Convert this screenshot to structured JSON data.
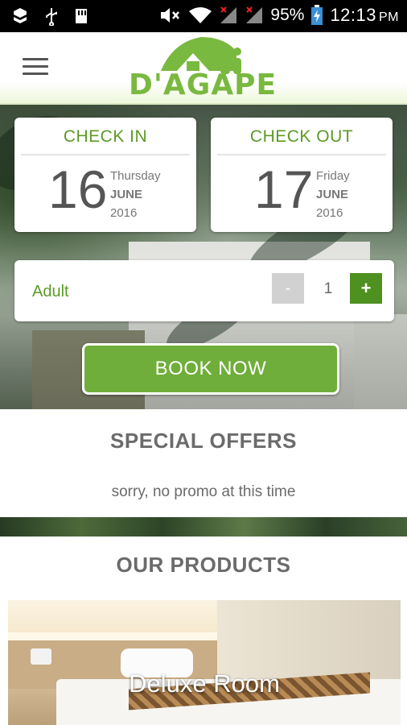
{
  "status_bar": {
    "battery_percent": "95%",
    "time": "12:13",
    "time_suffix": "PM"
  },
  "header": {
    "logo_text": "D'AGAPE",
    "brand_color": "#79b93f"
  },
  "booking": {
    "check_in": {
      "title": "CHECK IN",
      "day": "16",
      "weekday": "Thursday",
      "month": "JUNE",
      "year": "2016"
    },
    "check_out": {
      "title": "CHECK OUT",
      "day": "17",
      "weekday": "Friday",
      "month": "JUNE",
      "year": "2016"
    },
    "guest": {
      "label": "Adult",
      "minus": "-",
      "value": "1",
      "plus": "+"
    },
    "book_now_label": "BOOK NOW"
  },
  "special_offers": {
    "title": "SPECIAL OFFERS",
    "message": "sorry, no promo at this time"
  },
  "products": {
    "title": "OUR PRODUCTS",
    "items": [
      {
        "name": "Deluxe Room"
      }
    ]
  },
  "colors": {
    "accent_green": "#5c9a26",
    "button_green": "#6fae3a",
    "plus_green": "#4f9120",
    "minus_gray": "#d1d1d1",
    "text_gray": "#6b6b6b"
  }
}
